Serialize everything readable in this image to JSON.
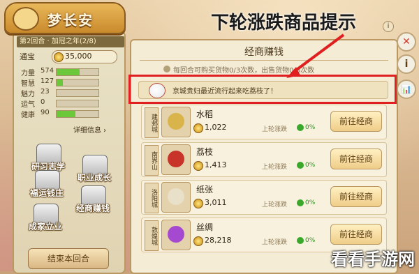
{
  "title": "梦长安",
  "round_info": "第2回合 · 加冠之年(2/8)",
  "money": {
    "label": "通宝",
    "value": "35,000"
  },
  "stats": [
    {
      "label": "力量",
      "value": "574",
      "fill": 0.55
    },
    {
      "label": "智慧",
      "value": "127",
      "fill": 0.15
    },
    {
      "label": "魅力",
      "value": "23",
      "fill": 0.0
    },
    {
      "label": "运气",
      "value": "0",
      "fill": 0.0
    },
    {
      "label": "健康",
      "value": "90",
      "fill": 0.45
    }
  ],
  "detail_link": "详细信息 ›",
  "side_actions": [
    {
      "label": "研习志学"
    },
    {
      "label": "职业成长"
    },
    {
      "label": "福运钱庄"
    },
    {
      "label": "经商赚钱"
    },
    {
      "label": "成家立业"
    }
  ],
  "end_round": "结束本回合",
  "main": {
    "title": "经商赚钱",
    "info": "每回合可购买货物0/3次数，出售货物0/3次数",
    "hint": "京城贵妇最近流行起来吃荔枝了！"
  },
  "goods": [
    {
      "tag": "建邺城",
      "name": "水稻",
      "price": "1,022",
      "change_label": "上轮涨跌",
      "change": "0%",
      "color": "#d9b44a"
    },
    {
      "tag": "南界山",
      "name": "荔枝",
      "price": "1,413",
      "change_label": "上轮涨跌",
      "change": "0%",
      "color": "#c8342a"
    },
    {
      "tag": "洛阳城",
      "name": "纸张",
      "price": "3,011",
      "change_label": "上轮涨跌",
      "change": "0%",
      "color": "#e8e0c8"
    },
    {
      "tag": "敦煌城",
      "name": "丝绸",
      "price": "28,218",
      "change_label": "上轮涨跌",
      "change": "0%",
      "color": "#a54ad0"
    }
  ],
  "go_button": "前往经商",
  "annotation": "下轮涨跌商品提示",
  "right_buttons": {
    "close": "✕",
    "info": "i",
    "chart": "📊"
  },
  "watermark": "看看手游网"
}
